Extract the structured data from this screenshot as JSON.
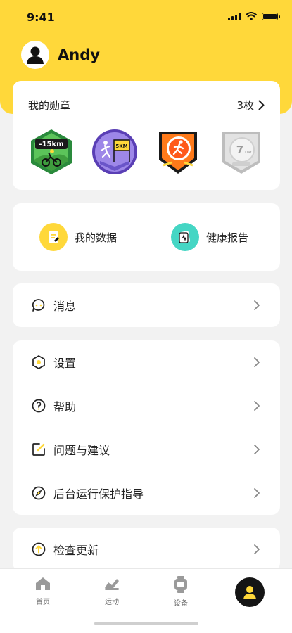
{
  "status_bar": {
    "time": "9:41"
  },
  "profile": {
    "name": "Andy"
  },
  "medals": {
    "title": "我的勋章",
    "count": "3枚",
    "items": [
      {
        "icon": "cycling-15km-medal",
        "text": "-15km"
      },
      {
        "icon": "running-5km-medal",
        "text": "5KM"
      },
      {
        "icon": "runner-medal",
        "text": ""
      },
      {
        "icon": "locked-7day-medal",
        "text": "7",
        "subtext": "DAY"
      }
    ]
  },
  "quick_links": {
    "my_data": "我的数据",
    "health_report": "健康报告"
  },
  "menu": {
    "messages": "消息",
    "settings": "设置",
    "help": "帮助",
    "feedback": "问题与建议",
    "background_guide": "后台运行保护指导",
    "check_update": "检查更新"
  },
  "tabbar": {
    "home": "首页",
    "sport": "运动",
    "device": "设备"
  },
  "colors": {
    "brand_yellow": "#ffd83a",
    "accent_teal": "#45d6c4",
    "tab_active": "#151515"
  }
}
